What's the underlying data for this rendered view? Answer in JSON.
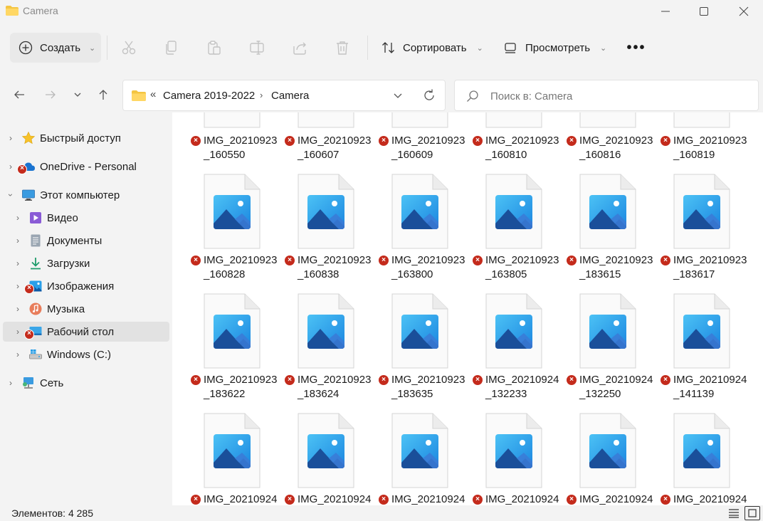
{
  "window": {
    "title": "Camera",
    "minimize_icon": "minimize-icon",
    "maximize_icon": "maximize-icon",
    "close_icon": "close-icon"
  },
  "toolbar": {
    "new_label": "Создать",
    "sort_label": "Сортировать",
    "view_label": "Просмотреть",
    "more_label": "•••",
    "icons": [
      "cut-icon",
      "copy-icon",
      "paste-icon",
      "rename-icon",
      "share-icon",
      "delete-icon"
    ]
  },
  "address": {
    "overflow_label": "«",
    "crumbs": [
      "Camera 2019-2022",
      "Camera"
    ],
    "separator": "›"
  },
  "search": {
    "placeholder": "Поиск в: Camera",
    "value": ""
  },
  "sidebar": {
    "items": [
      {
        "label": "Быстрый доступ",
        "icon": "star-icon",
        "error": false
      },
      {
        "label": "OneDrive - Personal",
        "icon": "cloud-icon",
        "error": true
      },
      {
        "label": "Этот компьютер",
        "icon": "computer-icon",
        "error": false
      },
      {
        "label": "Видео",
        "icon": "video-icon",
        "error": false
      },
      {
        "label": "Документы",
        "icon": "documents-icon",
        "error": false
      },
      {
        "label": "Загрузки",
        "icon": "downloads-icon",
        "error": false
      },
      {
        "label": "Изображения",
        "icon": "pictures-icon",
        "error": true
      },
      {
        "label": "Музыка",
        "icon": "music-icon",
        "error": false
      },
      {
        "label": "Рабочий стол",
        "icon": "desktop-icon",
        "error": true
      },
      {
        "label": "Windows (C:)",
        "icon": "drive-icon",
        "error": false
      },
      {
        "label": "Сеть",
        "icon": "network-icon",
        "error": false
      }
    ]
  },
  "files": {
    "rows": [
      [
        {
          "line1": "IMG_20210923",
          "line2": "_160550"
        },
        {
          "line1": "IMG_20210923",
          "line2": "_160607"
        },
        {
          "line1": "IMG_20210923",
          "line2": "_160609"
        },
        {
          "line1": "IMG_20210923",
          "line2": "_160810"
        },
        {
          "line1": "IMG_20210923",
          "line2": "_160816"
        },
        {
          "line1": "IMG_20210923",
          "line2": "_160819"
        }
      ],
      [
        {
          "line1": "IMG_20210923",
          "line2": "_160828"
        },
        {
          "line1": "IMG_20210923",
          "line2": "_160838"
        },
        {
          "line1": "IMG_20210923",
          "line2": "_163800"
        },
        {
          "line1": "IMG_20210923",
          "line2": "_163805"
        },
        {
          "line1": "IMG_20210923",
          "line2": "_183615"
        },
        {
          "line1": "IMG_20210923",
          "line2": "_183617"
        }
      ],
      [
        {
          "line1": "IMG_20210923",
          "line2": "_183622"
        },
        {
          "line1": "IMG_20210923",
          "line2": "_183624"
        },
        {
          "line1": "IMG_20210923",
          "line2": "_183635"
        },
        {
          "line1": "IMG_20210924",
          "line2": "_132233"
        },
        {
          "line1": "IMG_20210924",
          "line2": "_132250"
        },
        {
          "line1": "IMG_20210924",
          "line2": "_141139"
        }
      ],
      [
        {
          "line1": "IMG_20210924",
          "line2": ""
        },
        {
          "line1": "IMG_20210924",
          "line2": ""
        },
        {
          "line1": "IMG_20210924",
          "line2": ""
        },
        {
          "line1": "IMG_20210924",
          "line2": ""
        },
        {
          "line1": "IMG_20210924",
          "line2": ""
        },
        {
          "line1": "IMG_20210924",
          "line2": ""
        }
      ]
    ],
    "error_glyph": "×"
  },
  "status": {
    "item_count": "Элементов: 4 285"
  },
  "colors": {
    "error": "#c42b1c",
    "folder": "#f4c542",
    "thumb_blue": "#2a9fe8"
  }
}
